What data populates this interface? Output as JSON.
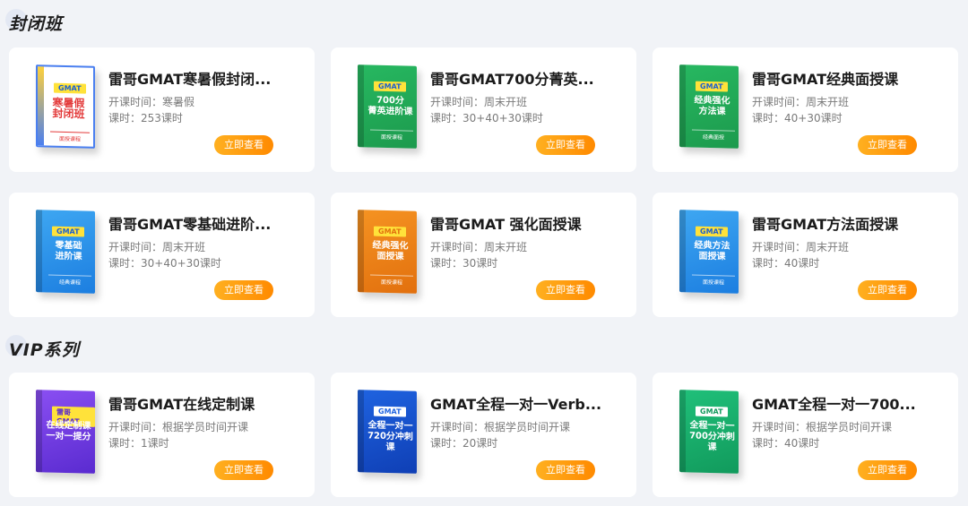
{
  "sections": [
    {
      "title": "封闭班"
    },
    {
      "title": "VIP系列"
    }
  ],
  "meta_labels": {
    "time": "开课时间：",
    "hours": "课时："
  },
  "button_label": "立即查看",
  "cards": [
    {
      "title": "雷哥GMAT寒暑假封闭...",
      "time": "寒暑假",
      "hours": "253课时",
      "cover": {
        "theme": "poster",
        "tag": "GMAT",
        "big": "寒暑假\n封闭班",
        "small": "面授课程"
      }
    },
    {
      "title": "雷哥GMAT700分菁英...",
      "time": "周末开班",
      "hours": "30+40+30课时",
      "cover": {
        "theme": "green",
        "tag": "GMAT",
        "big": "700分\n菁英进阶课",
        "small": "面授课程"
      }
    },
    {
      "title": "雷哥GMAT经典面授课",
      "time": "周末开班",
      "hours": "40+30课时",
      "cover": {
        "theme": "green",
        "tag": "GMAT",
        "big": "经典强化\n方法课",
        "small": "经典面授"
      }
    },
    {
      "title": "雷哥GMAT零基础进阶...",
      "time": "周末开班",
      "hours": "30+40+30课时",
      "cover": {
        "theme": "sky",
        "tag": "GMAT",
        "big": "零基础\n进阶课",
        "small": "经典课程"
      }
    },
    {
      "title": "雷哥GMAT 强化面授课",
      "time": "周末开班",
      "hours": "30课时",
      "cover": {
        "theme": "orange",
        "tag": "GMAT",
        "big": "经典强化\n面授课",
        "small": "面授课程"
      }
    },
    {
      "title": "雷哥GMAT方法面授课",
      "time": "周末开班",
      "hours": "40课时",
      "cover": {
        "theme": "sky",
        "tag": "GMAT",
        "big": "经典方法\n面授课",
        "small": "面授课程"
      }
    },
    {
      "title": "雷哥GMAT在线定制课",
      "time": "根据学员时间开课",
      "hours": "1课时",
      "cover": {
        "theme": "purple",
        "tag": "雷哥GMAT",
        "big": "在线定制课\n一对一提分",
        "small": ""
      }
    },
    {
      "title": "GMAT全程一对一Verb...",
      "time": "根据学员时间开课",
      "hours": "20课时",
      "cover": {
        "theme": "navy",
        "tag": "GMAT",
        "big": "全程一对一\n720分冲刺课",
        "small": ""
      }
    },
    {
      "title": "GMAT全程一对一700...",
      "time": "根据学员时间开课",
      "hours": "40课时",
      "cover": {
        "theme": "teal",
        "tag": "GMAT",
        "big": "全程一对一\n700分冲刺课",
        "small": ""
      }
    }
  ]
}
